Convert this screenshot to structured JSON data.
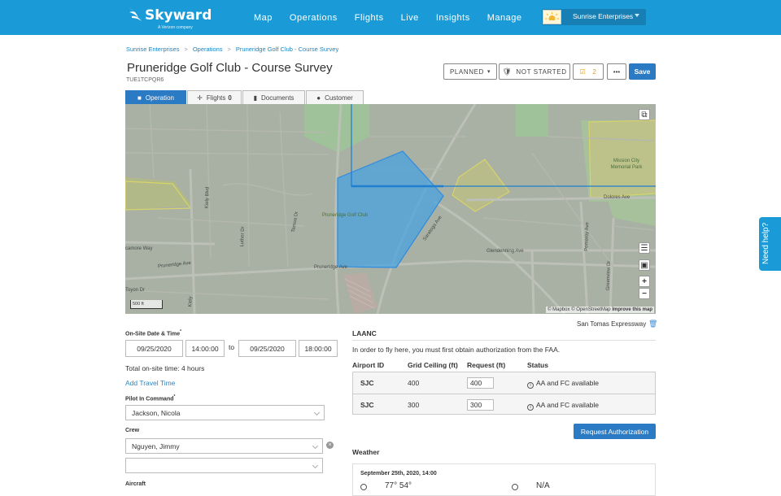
{
  "brand": {
    "name": "Skyward",
    "tagline": "A Verizon company"
  },
  "nav": [
    "Map",
    "Operations",
    "Flights",
    "Live",
    "Insights",
    "Manage"
  ],
  "org": {
    "name": "Sunrise Enterprises"
  },
  "breadcrumb": [
    "Sunrise Enterprises",
    "Operations",
    "Pruneridge Golf Club - Course Survey"
  ],
  "page": {
    "title": "Pruneridge Golf Club - Course Survey",
    "id": "TUE1TCPQR6"
  },
  "toolbar": {
    "status": "PLANNED",
    "progress": "NOT STARTED",
    "checklist_count": "2",
    "more": "•••",
    "save": "Save"
  },
  "tabs": [
    {
      "label": "Operation",
      "icon": "folder-icon"
    },
    {
      "label": "Flights",
      "count": "0",
      "icon": "airplane-icon"
    },
    {
      "label": "Documents",
      "icon": "document-icon"
    },
    {
      "label": "Customer",
      "icon": "person-icon"
    }
  ],
  "map": {
    "labels": {
      "golf": "Pruneridge Golf Club",
      "park": "Mission City Memorial Park",
      "dolores": "Dolores Ave",
      "glendenning": "Glendenning Ave",
      "pruneridge1": "Pruneridge Ave",
      "pruneridge2": "Pruneridge Ave",
      "saratoga": "Saratoga Ave",
      "tamoa": "Tamoa Dr",
      "luther": "Luther Dr",
      "kiely": "Kiely Blvd",
      "kiely2": "Kiely",
      "camore": "camore Way",
      "toyon": "Toyon Dr",
      "pomeroy": "Pomeroy Ave",
      "greenview": "Greenview Dr"
    },
    "scale": "500 ft",
    "attribution": {
      "mapbox": "© Mapbox",
      "osm": "© OpenStreetMap",
      "improve": "Improve this map"
    },
    "colors": {
      "polygon": "#4aa3e0",
      "boundary": "#1f7fd0"
    }
  },
  "location": "San Tomas Expressway",
  "form": {
    "onsite_label": "On-Site Date & Time",
    "required_mark": "*",
    "start_date": "09/25/2020",
    "start_time": "14:00:00",
    "to": "to",
    "end_date": "09/25/2020",
    "end_time": "18:00:00",
    "total": "Total on-site time: 4 hours",
    "add_travel": "Add Travel Time",
    "pic_label": "Pilot In Command",
    "pic_value": "Jackson, Nicola",
    "crew_label": "Crew",
    "crew_value": "Nguyen, Jimmy",
    "crew_empty": "",
    "aircraft_label": "Aircraft"
  },
  "laanc": {
    "title": "LAANC",
    "desc": "In order to fly here, you must first obtain authorization from the FAA.",
    "headers": [
      "Airport ID",
      "Grid Ceiling (ft)",
      "Request (ft)",
      "Status"
    ],
    "rows": [
      {
        "airport": "SJC",
        "ceiling": "400",
        "request": "400",
        "status": "AA and FC available"
      },
      {
        "airport": "SJC",
        "ceiling": "300",
        "request": "300",
        "status": "AA and FC available"
      }
    ],
    "button": "Request Authorization"
  },
  "weather": {
    "title": "Weather",
    "date": "September 25th, 2020, 14:00",
    "temp": "77° 54°",
    "wind": "N/A"
  },
  "help": "Need help?"
}
